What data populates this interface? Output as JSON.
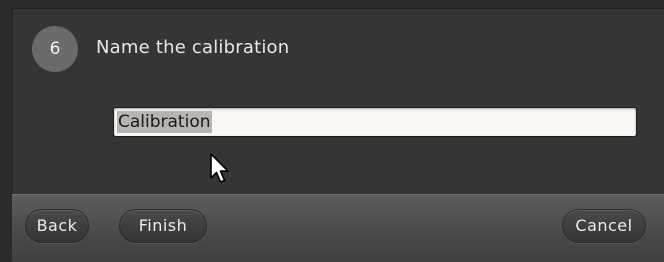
{
  "step": {
    "number": "6",
    "title": "Name the calibration"
  },
  "name_field": {
    "value": "Calibration"
  },
  "footer": {
    "back_label": "Back",
    "finish_label": "Finish",
    "cancel_label": "Cancel"
  },
  "icons": {
    "cursor": "mouse-pointer-icon"
  },
  "colors": {
    "background": "#353535",
    "step_circle": "#6b6b6b",
    "input_background": "#fbf7f4",
    "button": "#3e3e3e"
  }
}
